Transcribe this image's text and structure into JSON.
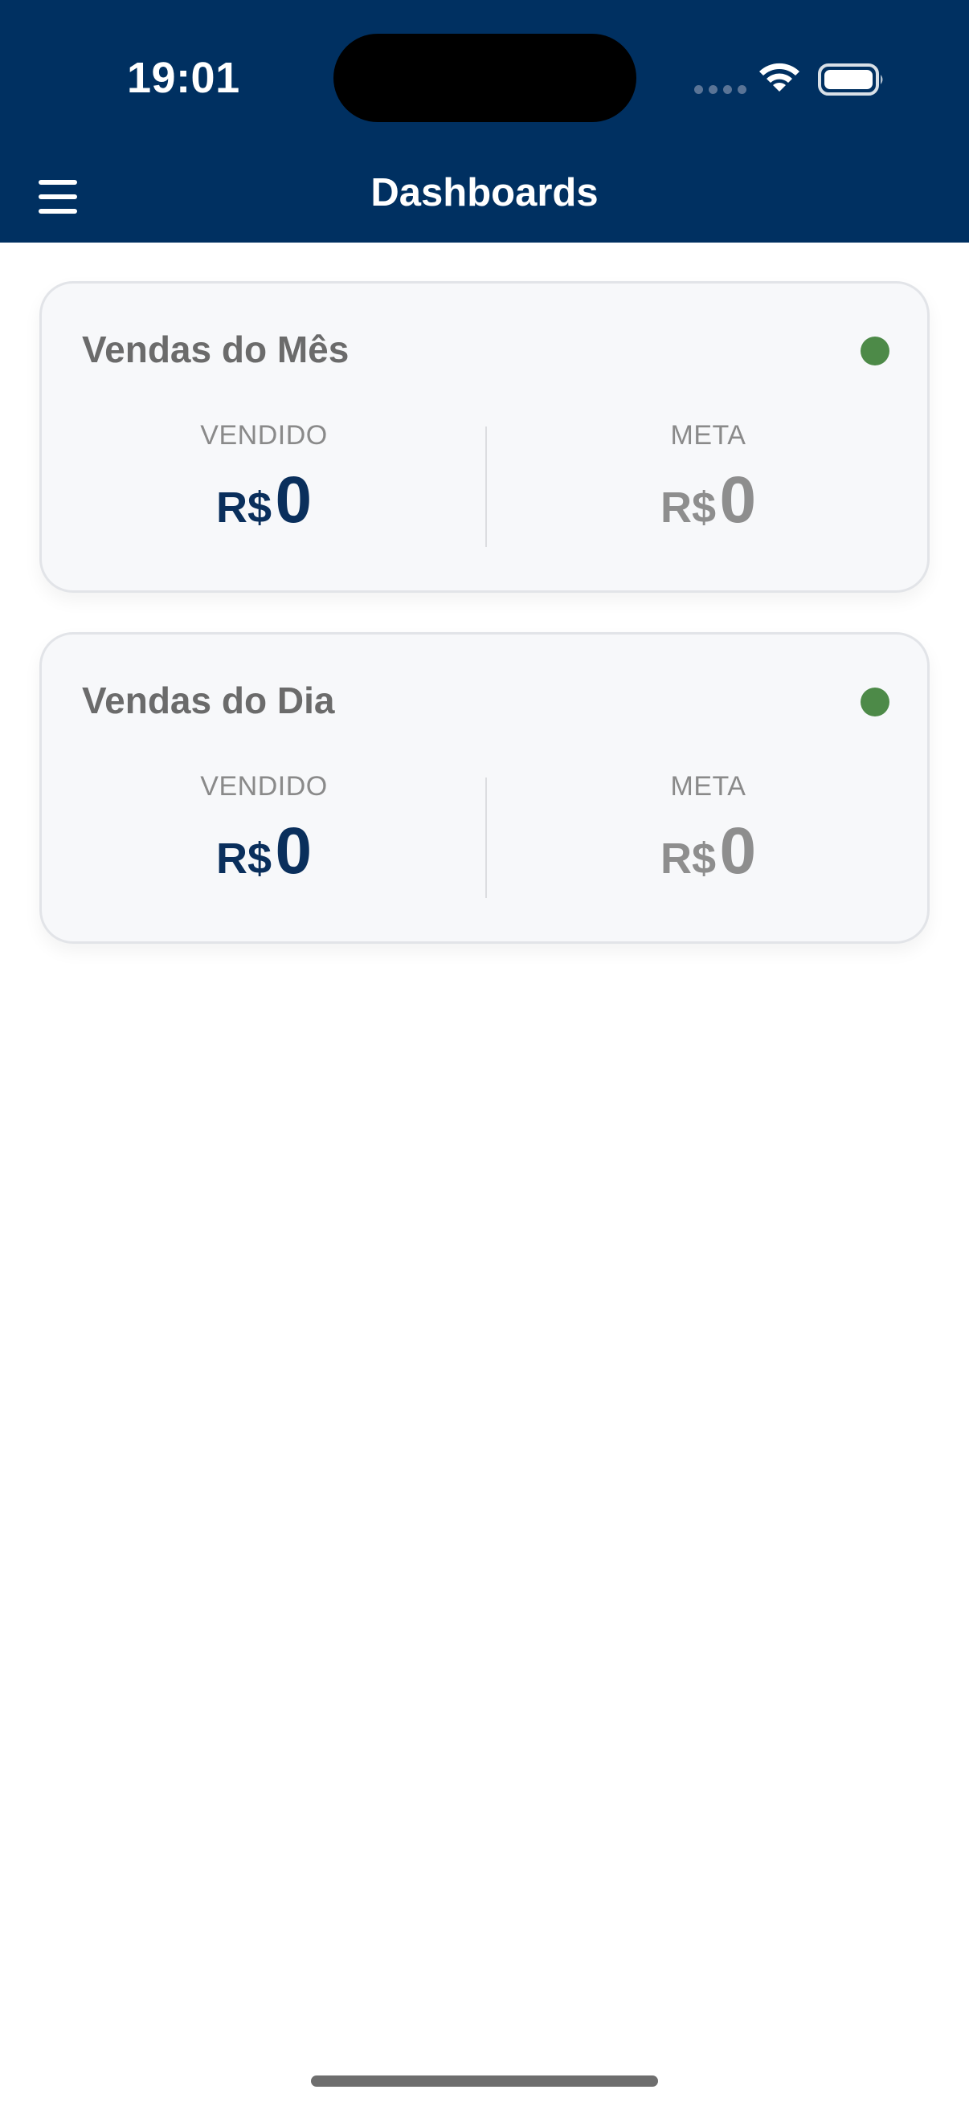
{
  "status_bar": {
    "time": "19:01",
    "icons": [
      "signal-icon",
      "wifi-icon",
      "battery-icon"
    ]
  },
  "header": {
    "title": "Dashboards",
    "menu_icon": "hamburger-menu-icon"
  },
  "cards": [
    {
      "title": "Vendas do Mês",
      "sold_label": "VENDIDO",
      "sold_currency": "R$",
      "sold_value": "0",
      "goal_label": "META",
      "goal_currency": "R$",
      "goal_value": "0"
    },
    {
      "title": "Vendas do Dia",
      "sold_label": "VENDIDO",
      "sold_currency": "R$",
      "sold_value": "0",
      "goal_label": "META",
      "goal_currency": "R$",
      "goal_value": "0"
    }
  ],
  "colors": {
    "header_bg": "#003061",
    "status_dot": "#4d8a48",
    "sold_value": "#0a2f5c",
    "goal_value": "#8e8e8e"
  }
}
